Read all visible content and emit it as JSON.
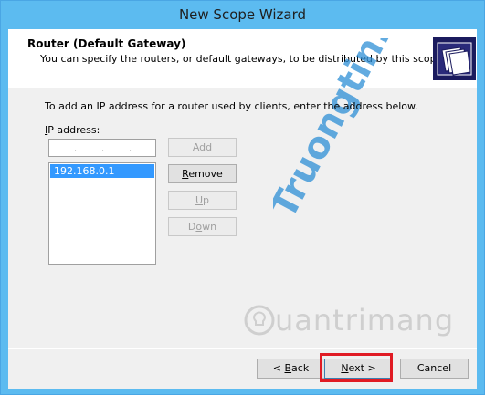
{
  "window": {
    "title": "New Scope Wizard"
  },
  "header": {
    "title": "Router (Default Gateway)",
    "subtitle": "You can specify the routers, or default gateways, to be distributed by this scope."
  },
  "body": {
    "instruction": "To add an IP address for a router used by clients, enter the address below.",
    "ip_label_mnemonic": "I",
    "ip_label_rest": "P address:",
    "ip_input_value": "",
    "router_list": [
      "192.168.0.1"
    ]
  },
  "buttons": {
    "add": "Add",
    "remove_mnemonic": "R",
    "remove_rest": "emove",
    "up_mnemonic": "U",
    "up_rest": "p",
    "down_pre": "D",
    "down_mnemonic": "o",
    "down_rest": "wn",
    "back_pre": "< ",
    "back_mnemonic": "B",
    "back_rest": "ack",
    "next_mnemonic": "N",
    "next_rest": "ext >",
    "cancel": "Cancel"
  },
  "watermarks": {
    "logo_text": "Truongtin.top",
    "brand_text": "uantrimang"
  },
  "colors": {
    "titlebar": "#5cbbf0",
    "selection": "#3399ff",
    "highlight_box": "#e01b24"
  }
}
